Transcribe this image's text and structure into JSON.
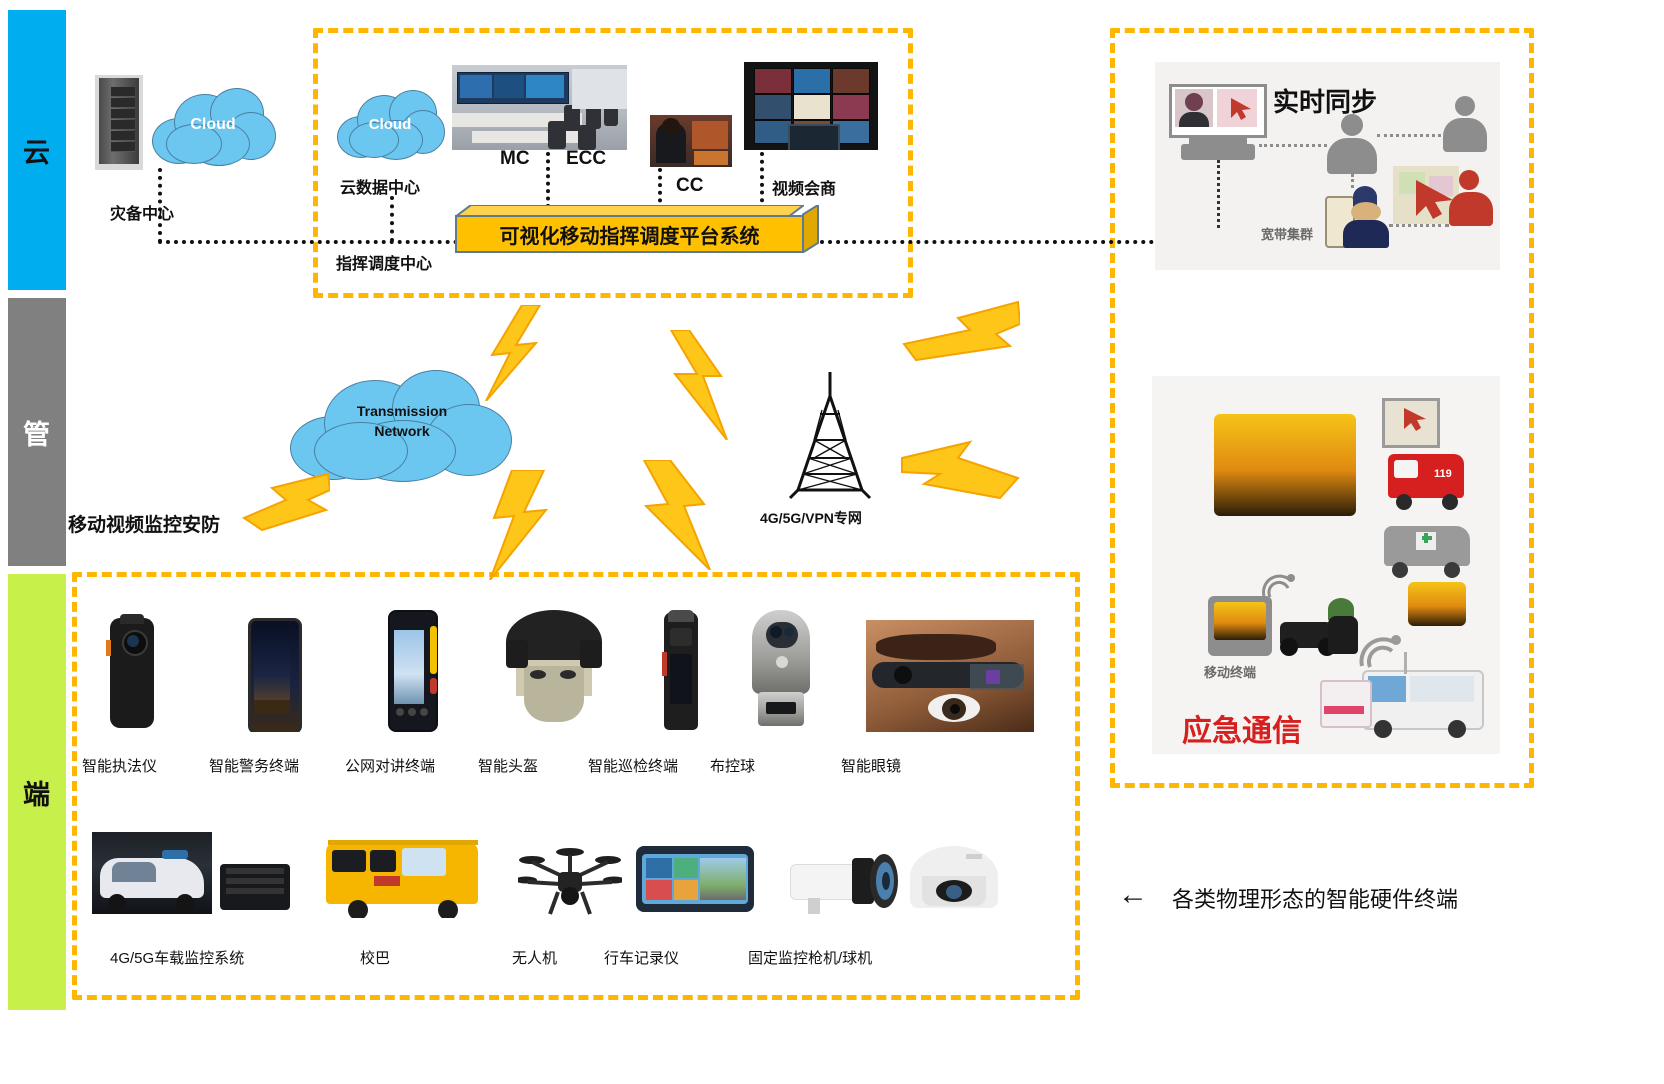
{
  "layers": [
    {
      "key": "cloud",
      "label": "云",
      "color": "#00AEEF"
    },
    {
      "key": "pipe",
      "label": "管",
      "color": "#808080"
    },
    {
      "key": "edge",
      "label": "端",
      "color": "#C8F04A"
    }
  ],
  "cloud_layer": {
    "disaster_cloud_label": "Cloud",
    "disaster_center_label": "灾备中心",
    "data_cloud_label": "Cloud",
    "data_center_label": "云数据中心",
    "command_center_label": "指挥调度中心",
    "nodes": [
      {
        "name": "MC",
        "type": "control-room-photo"
      },
      {
        "name": "ECC",
        "type": "control-room-photo"
      },
      {
        "name": "CC",
        "type": "dispatcher-photo"
      },
      {
        "name": "视频会商",
        "type": "video-conference-photo"
      }
    ],
    "platform_label": "可视化移动指挥调度平台系统"
  },
  "pipe_layer": {
    "transmission_cloud_label": "Transmission\nNetwork",
    "transmission_cloud_line1": "Transmission",
    "transmission_cloud_line2": "Network",
    "tower_label": "4G/5G/VPN专网",
    "security_label": "移动视频监控安防"
  },
  "terminals": {
    "row1": [
      {
        "label": "智能执法仪",
        "icon": "body-camera"
      },
      {
        "label": "智能警务终端",
        "icon": "rugged-smartphone"
      },
      {
        "label": "公网对讲终端",
        "icon": "ptt-radio"
      },
      {
        "label": "智能头盔",
        "icon": "smart-helmet"
      },
      {
        "label": "智能巡检终端",
        "icon": "inspection-terminal"
      },
      {
        "label": "布控球",
        "icon": "ptz-camera-ball"
      },
      {
        "label": "智能眼镜",
        "icon": "smart-glasses"
      }
    ],
    "row2": [
      {
        "label": "4G/5G车载监控系统",
        "icon": "vehicle-surveillance"
      },
      {
        "label": "校巴",
        "icon": "school-bus"
      },
      {
        "label": "无人机",
        "icon": "drone"
      },
      {
        "label": "行车记录仪",
        "icon": "dashcam-mirror"
      },
      {
        "label": "固定监控枪机/球机",
        "icon": "fixed-cameras"
      }
    ],
    "annotation": "各类物理形态的智能硬件终端",
    "annotation_arrow": "←"
  },
  "right_panels": {
    "top": {
      "title": "实时同步",
      "caption": "宽带集群"
    },
    "bottom": {
      "title": "应急通信",
      "caption": "移动终端",
      "vehicle_badge": "119"
    }
  },
  "colors": {
    "accent_orange": "#FFB600",
    "platform_fill": "#FFC000",
    "cloud_blue": "#6CC7F0",
    "band_cloud": "#00AEEF",
    "band_pipe": "#808080",
    "band_edge": "#C8F04A",
    "bolt": "#FFC61A"
  }
}
